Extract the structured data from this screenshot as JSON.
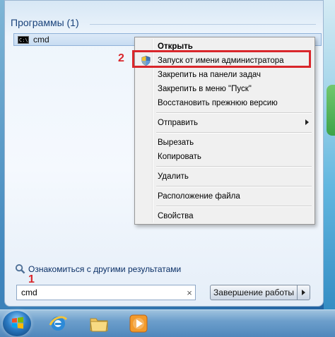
{
  "start_menu": {
    "section_title": "Программы (1)",
    "results": [
      {
        "label": "cmd",
        "icon": "cmd-icon"
      }
    ],
    "see_more_label": "Ознакомиться с другими результатами",
    "search_value": "cmd",
    "shutdown_label": "Завершение работы"
  },
  "context_menu": {
    "items": [
      {
        "label": "Открыть",
        "bold": true
      },
      {
        "label": "Запуск от имени администратора",
        "icon": "shield-icon"
      },
      {
        "label": "Закрепить на панели задач"
      },
      {
        "label": "Закрепить в меню \"Пуск\""
      },
      {
        "label": "Восстановить прежнюю версию"
      },
      {
        "label": "Отправить",
        "submenu": true
      },
      {
        "label": "Вырезать"
      },
      {
        "label": "Копировать"
      },
      {
        "label": "Удалить"
      },
      {
        "label": "Расположение файла"
      },
      {
        "label": "Свойства"
      }
    ]
  },
  "annotations": {
    "step1": "1",
    "step2": "2",
    "highlight_color": "#d9262b"
  },
  "taskbar": {
    "icons": [
      "windows-start-orb",
      "internet-explorer-icon",
      "folder-icon",
      "media-player-icon"
    ]
  }
}
